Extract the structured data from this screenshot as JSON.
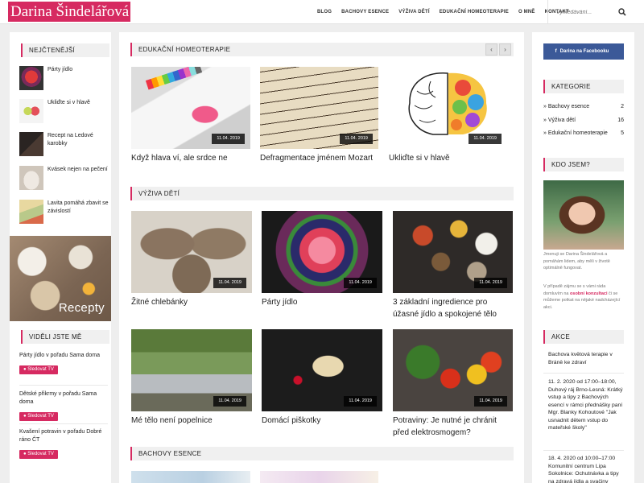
{
  "header": {
    "logo": "Darina Šindelářová",
    "nav": [
      "BLOG",
      "BACHOVY ESENCE",
      "VÝŽIVA DĚTÍ",
      "EDUKAČNÍ HOMEOTERAPIE",
      "O MNĚ",
      "KONTAKT"
    ],
    "search_placeholder": "Vyhledávání...",
    "search_icon": "search-icon"
  },
  "left": {
    "popular_heading": "NEJČTENĚJŠÍ",
    "popular": [
      "Párty jídlo",
      "Ukliďte si v hlavě",
      "Recept na Ledové karobky",
      "Kvásek nejen na pečení",
      "Lavita pomáhá zbavit se závislostí"
    ],
    "banner_label": "Recepty",
    "seen_heading": "VIDĚLI JSTE MĚ",
    "seen": [
      {
        "title": "Párty jídlo v pořadu Sama doma",
        "button": "Sledovat TV"
      },
      {
        "title": "Dětské přikrmy v pořadu Sama doma",
        "button": "Sledovat TV"
      },
      {
        "title": "Kvašení potravin v pořadu Dobré ráno ČT",
        "button": "Sledovat TV"
      }
    ]
  },
  "main": {
    "homeo": {
      "heading": "EDUKAČNÍ HOMEOTERAPIE",
      "prev": "‹",
      "next": "›",
      "cards": [
        {
          "title": "Když hlava ví, ale srdce ne",
          "date": "11.04. 2019"
        },
        {
          "title": "Defragmentace jménem Mozart",
          "date": "11.04. 2019"
        },
        {
          "title": "Ukliďte si v hlavě",
          "date": "11.04. 2019"
        }
      ]
    },
    "vyziva": {
      "heading": "VÝŽIVA DĚTÍ",
      "cards": [
        {
          "title": "Žitné chlebánky",
          "date": "11.04. 2019"
        },
        {
          "title": "Párty jídlo",
          "date": "11.04. 2019"
        },
        {
          "title": "3 základní ingredience pro úžasné jídlo a spokojené tělo",
          "date": "11.04. 2019"
        },
        {
          "title": "Mé tělo není popelnice",
          "date": "11.04. 2019"
        },
        {
          "title": "Domácí piškotky",
          "date": "11.04. 2019"
        },
        {
          "title": "Potraviny: Je nutné je chránit před elektrosmogem?",
          "date": "11.04. 2019"
        }
      ]
    },
    "bach": {
      "heading": "BACHOVY ESENCE"
    }
  },
  "right": {
    "facebook": "Darina na Facebooku",
    "categories_heading": "KATEGORIE",
    "categories": [
      {
        "name": "» Bachovy esence",
        "count": "2"
      },
      {
        "name": "» Výživa dětí",
        "count": "16"
      },
      {
        "name": "» Edukační homeoterapie",
        "count": "5"
      }
    ],
    "about_heading": "KDO JSEM?",
    "about_p1": "Jmenuji se Darina Šindelářová a pomáhám lidem, aby měli v životě optimálně fungovat.",
    "about_p2_a": "V případě zájmu se s vámi ráda domluvím na",
    "about_p2_link": "osobní konzultaci",
    "about_p2_b": "či se můžeme potkat na nějaké nadcházející akci.",
    "events_heading": "AKCE",
    "events": [
      "Bachova květová terapie v Bráně ke zdraví",
      "11. 2. 2020 od 17:00–18:00, Duhový ráj Brno-Lesná: Krátký vstup a tipy z Bachových esencí v rámci přednášky paní Mgr. Blanky Kohoutové \"Jak usnadnit dětem vstup do mateřské školy\"",
      "18. 4. 2020 od 10:00–17:00 Komunitní centrum Lipa Sokolnice: Ochutnávka a tipy na zdravá jídla a svačiny"
    ]
  },
  "colors": {
    "accent": "#d62a61",
    "facebook": "#3b5998",
    "background": "#eeeeee"
  }
}
